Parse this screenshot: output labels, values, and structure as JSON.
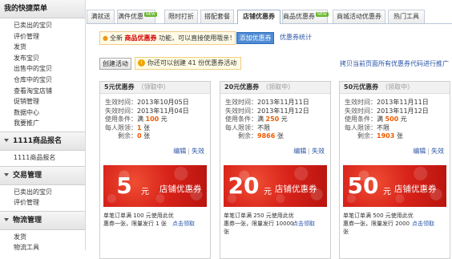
{
  "sidebar": {
    "quick_menu": {
      "title": "我的快捷菜单",
      "items": [
        "已卖出的宝贝",
        "评价管理",
        "发货",
        "发布宝贝",
        "出售中的宝贝",
        "仓库中的宝贝",
        "查看淘宝店铺",
        "促销管理",
        "数据中心",
        "我要推广"
      ]
    },
    "sections": [
      {
        "title": "1111商品报名",
        "items": [
          "1111商品报名"
        ]
      },
      {
        "title": "交易管理",
        "items": [
          "已卖出的宝贝",
          "评价管理"
        ]
      },
      {
        "title": "物流管理",
        "items": [
          "发货",
          "物流工具"
        ]
      }
    ]
  },
  "tabs": [
    {
      "label": "满就送",
      "new": false
    },
    {
      "label": "满件优惠",
      "new": true
    },
    {
      "label": "限时打折",
      "new": false
    },
    {
      "label": "搭配套餐",
      "new": false
    },
    {
      "label": "店铺优惠券",
      "new": false
    },
    {
      "label": "商品优惠券",
      "new": true
    },
    {
      "label": "商城活动优惠券",
      "new": false
    },
    {
      "label": "热门工具",
      "new": false
    }
  ],
  "new_badge": "NEW",
  "notice": {
    "prefix": "全新",
    "highlight": "商品优惠券",
    "suffix": "功能，可以直接使用哦亲！"
  },
  "add_coupon_label": "添加优惠券",
  "stats_link": "优惠券统计",
  "create_button": "创建活动",
  "tip_icon": "!",
  "tip_text": "你还可以创建 41 份优惠券活动",
  "right_link": "拷贝当前页面所有优惠券代码进行推广",
  "cards": [
    {
      "title": "5元优惠券",
      "status": "（领取中）",
      "start": "2013年10月05日",
      "end": "2013年11月04日",
      "condition_prefix": "满",
      "condition_amount": "100",
      "condition_unit": "元",
      "limit": "1",
      "limit_unit": "张",
      "remaining": "0",
      "remaining_unit": "张",
      "amount": "5",
      "desc": "单笔订单满 100 元使用此优惠券一张，限量发行 1 张",
      "get_link": "点击领取"
    },
    {
      "title": "20元优惠券",
      "status": "（领取中）",
      "start": "2013年11月11日",
      "end": "2013年11月12日",
      "condition_prefix": "满",
      "condition_amount": "250",
      "condition_unit": "元",
      "limit": "不限",
      "limit_unit": "",
      "remaining": "9866",
      "remaining_unit": "张",
      "amount": "20",
      "desc": "单笔订单满 250 元使用此优惠券一张，限量发行 10000 张",
      "get_link": "点击领取"
    },
    {
      "title": "50元优惠券",
      "status": "（领取中）",
      "start": "2013年11月11日",
      "end": "2013年11月12日",
      "condition_prefix": "满",
      "condition_amount": "500",
      "condition_unit": "元",
      "limit": "不限",
      "limit_unit": "",
      "remaining": "1903",
      "remaining_unit": "张",
      "amount": "50",
      "desc": "单笔订单满 500 元使用此优惠券一张，限量发行 2000 张",
      "get_link": "点击领取"
    }
  ],
  "labels": {
    "start": "生效时间：",
    "end": "失效时间：",
    "condition": "使用条件：",
    "limit": "每人限领：",
    "remaining": "剩余：",
    "edit": "编辑",
    "sep": "|",
    "invalidate": "失效",
    "unit": "元",
    "coupon_label": "店铺优惠券"
  }
}
